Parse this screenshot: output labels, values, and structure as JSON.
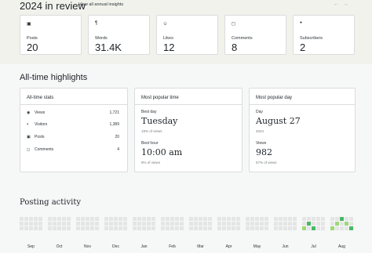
{
  "review": {
    "title": "2024 in review",
    "link": "View all annual insights",
    "prev_arrow": "←",
    "next_arrow": "→",
    "cards": [
      {
        "icon": "▣",
        "icon_name": "posts-icon",
        "label": "Posts",
        "value": "20"
      },
      {
        "icon": "¶",
        "icon_name": "words-icon",
        "label": "Words",
        "value": "31.4K"
      },
      {
        "icon": "✩",
        "icon_name": "likes-icon",
        "label": "Likes",
        "value": "12"
      },
      {
        "icon": "◻",
        "icon_name": "comments-icon",
        "label": "Comments",
        "value": "8"
      },
      {
        "icon": "ꔷ",
        "icon_name": "subscribers-icon",
        "label": "Subscribers",
        "value": "2"
      }
    ]
  },
  "highlights": {
    "title": "All-time highlights",
    "stats": {
      "title": "All-time stats",
      "rows": [
        {
          "icon": "◉",
          "icon_name": "eye-icon",
          "label": "Views",
          "value": "1,721"
        },
        {
          "icon": "ꔷ",
          "icon_name": "people-icon",
          "label": "Visitors",
          "value": "1,389"
        },
        {
          "icon": "▣",
          "icon_name": "posts-icon",
          "label": "Posts",
          "value": "20"
        },
        {
          "icon": "◻",
          "icon_name": "comments-icon",
          "label": "Comments",
          "value": "4"
        }
      ]
    },
    "popular_time": {
      "title": "Most popular time",
      "best_day_label": "Best day",
      "best_day": "Tuesday",
      "best_day_pct": "19% of views",
      "best_hour_label": "Best hour",
      "best_hour": "10:00 am",
      "best_hour_pct": "9% of views"
    },
    "popular_day": {
      "title": "Most popular day",
      "day_label": "Day",
      "day": "August 27",
      "year": "2024",
      "views_label": "Views",
      "views": "982",
      "views_pct": "57% of views"
    }
  },
  "activity": {
    "title": "Posting activity",
    "months": [
      "Sep",
      "Oct",
      "Nov",
      "Dec",
      "Jan",
      "Feb",
      "Mar",
      "Apr",
      "May",
      "Jun",
      "Jul",
      "Aug"
    ],
    "colors": {
      "empty": "#e5e5e5",
      "low": "#9dd977",
      "high": "#4ab866"
    },
    "active_cells": [
      {
        "month": 10,
        "col": 1,
        "row": 1,
        "level": "high"
      },
      {
        "month": 10,
        "col": 0,
        "row": 2,
        "level": "low"
      },
      {
        "month": 10,
        "col": 2,
        "row": 2,
        "level": "high"
      },
      {
        "month": 11,
        "col": 2,
        "row": 0,
        "level": "high"
      },
      {
        "month": 11,
        "col": 1,
        "row": 1,
        "level": "low"
      },
      {
        "month": 11,
        "col": 3,
        "row": 1,
        "level": "low"
      },
      {
        "month": 11,
        "col": 0,
        "row": 2,
        "level": "low"
      },
      {
        "month": 11,
        "col": 4,
        "row": 2,
        "level": "high"
      }
    ]
  }
}
